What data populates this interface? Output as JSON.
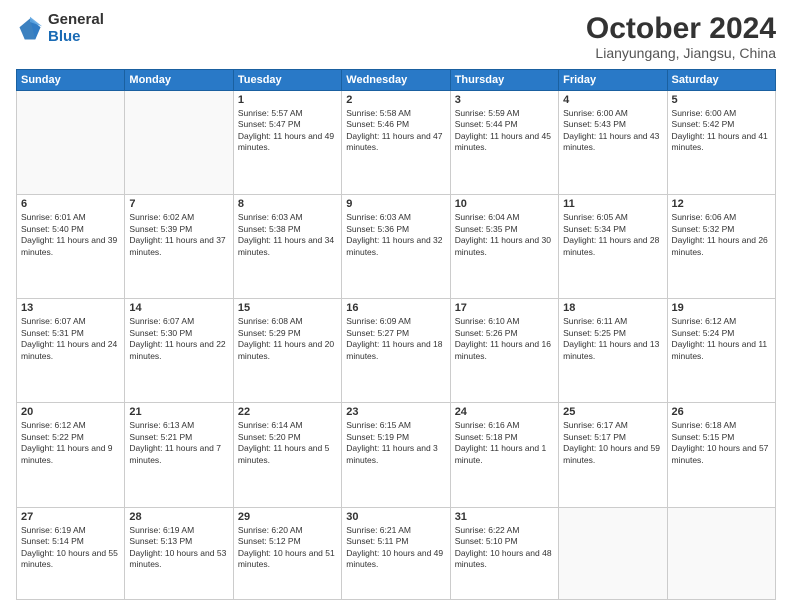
{
  "logo": {
    "general": "General",
    "blue": "Blue"
  },
  "title": "October 2024",
  "location": "Lianyungang, Jiangsu, China",
  "weekdays": [
    "Sunday",
    "Monday",
    "Tuesday",
    "Wednesday",
    "Thursday",
    "Friday",
    "Saturday"
  ],
  "weeks": [
    [
      {
        "day": "",
        "detail": ""
      },
      {
        "day": "",
        "detail": ""
      },
      {
        "day": "1",
        "detail": "Sunrise: 5:57 AM\nSunset: 5:47 PM\nDaylight: 11 hours and 49 minutes."
      },
      {
        "day": "2",
        "detail": "Sunrise: 5:58 AM\nSunset: 5:46 PM\nDaylight: 11 hours and 47 minutes."
      },
      {
        "day": "3",
        "detail": "Sunrise: 5:59 AM\nSunset: 5:44 PM\nDaylight: 11 hours and 45 minutes."
      },
      {
        "day": "4",
        "detail": "Sunrise: 6:00 AM\nSunset: 5:43 PM\nDaylight: 11 hours and 43 minutes."
      },
      {
        "day": "5",
        "detail": "Sunrise: 6:00 AM\nSunset: 5:42 PM\nDaylight: 11 hours and 41 minutes."
      }
    ],
    [
      {
        "day": "6",
        "detail": "Sunrise: 6:01 AM\nSunset: 5:40 PM\nDaylight: 11 hours and 39 minutes."
      },
      {
        "day": "7",
        "detail": "Sunrise: 6:02 AM\nSunset: 5:39 PM\nDaylight: 11 hours and 37 minutes."
      },
      {
        "day": "8",
        "detail": "Sunrise: 6:03 AM\nSunset: 5:38 PM\nDaylight: 11 hours and 34 minutes."
      },
      {
        "day": "9",
        "detail": "Sunrise: 6:03 AM\nSunset: 5:36 PM\nDaylight: 11 hours and 32 minutes."
      },
      {
        "day": "10",
        "detail": "Sunrise: 6:04 AM\nSunset: 5:35 PM\nDaylight: 11 hours and 30 minutes."
      },
      {
        "day": "11",
        "detail": "Sunrise: 6:05 AM\nSunset: 5:34 PM\nDaylight: 11 hours and 28 minutes."
      },
      {
        "day": "12",
        "detail": "Sunrise: 6:06 AM\nSunset: 5:32 PM\nDaylight: 11 hours and 26 minutes."
      }
    ],
    [
      {
        "day": "13",
        "detail": "Sunrise: 6:07 AM\nSunset: 5:31 PM\nDaylight: 11 hours and 24 minutes."
      },
      {
        "day": "14",
        "detail": "Sunrise: 6:07 AM\nSunset: 5:30 PM\nDaylight: 11 hours and 22 minutes."
      },
      {
        "day": "15",
        "detail": "Sunrise: 6:08 AM\nSunset: 5:29 PM\nDaylight: 11 hours and 20 minutes."
      },
      {
        "day": "16",
        "detail": "Sunrise: 6:09 AM\nSunset: 5:27 PM\nDaylight: 11 hours and 18 minutes."
      },
      {
        "day": "17",
        "detail": "Sunrise: 6:10 AM\nSunset: 5:26 PM\nDaylight: 11 hours and 16 minutes."
      },
      {
        "day": "18",
        "detail": "Sunrise: 6:11 AM\nSunset: 5:25 PM\nDaylight: 11 hours and 13 minutes."
      },
      {
        "day": "19",
        "detail": "Sunrise: 6:12 AM\nSunset: 5:24 PM\nDaylight: 11 hours and 11 minutes."
      }
    ],
    [
      {
        "day": "20",
        "detail": "Sunrise: 6:12 AM\nSunset: 5:22 PM\nDaylight: 11 hours and 9 minutes."
      },
      {
        "day": "21",
        "detail": "Sunrise: 6:13 AM\nSunset: 5:21 PM\nDaylight: 11 hours and 7 minutes."
      },
      {
        "day": "22",
        "detail": "Sunrise: 6:14 AM\nSunset: 5:20 PM\nDaylight: 11 hours and 5 minutes."
      },
      {
        "day": "23",
        "detail": "Sunrise: 6:15 AM\nSunset: 5:19 PM\nDaylight: 11 hours and 3 minutes."
      },
      {
        "day": "24",
        "detail": "Sunrise: 6:16 AM\nSunset: 5:18 PM\nDaylight: 11 hours and 1 minute."
      },
      {
        "day": "25",
        "detail": "Sunrise: 6:17 AM\nSunset: 5:17 PM\nDaylight: 10 hours and 59 minutes."
      },
      {
        "day": "26",
        "detail": "Sunrise: 6:18 AM\nSunset: 5:15 PM\nDaylight: 10 hours and 57 minutes."
      }
    ],
    [
      {
        "day": "27",
        "detail": "Sunrise: 6:19 AM\nSunset: 5:14 PM\nDaylight: 10 hours and 55 minutes."
      },
      {
        "day": "28",
        "detail": "Sunrise: 6:19 AM\nSunset: 5:13 PM\nDaylight: 10 hours and 53 minutes."
      },
      {
        "day": "29",
        "detail": "Sunrise: 6:20 AM\nSunset: 5:12 PM\nDaylight: 10 hours and 51 minutes."
      },
      {
        "day": "30",
        "detail": "Sunrise: 6:21 AM\nSunset: 5:11 PM\nDaylight: 10 hours and 49 minutes."
      },
      {
        "day": "31",
        "detail": "Sunrise: 6:22 AM\nSunset: 5:10 PM\nDaylight: 10 hours and 48 minutes."
      },
      {
        "day": "",
        "detail": ""
      },
      {
        "day": "",
        "detail": ""
      }
    ]
  ]
}
